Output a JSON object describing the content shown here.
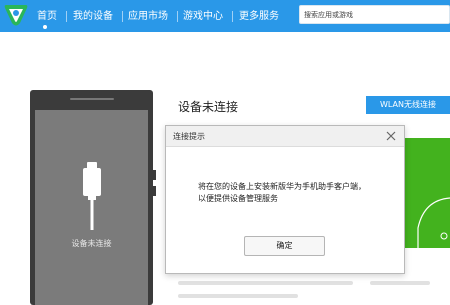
{
  "header": {
    "logo_icon": "app-logo-icon",
    "nav": [
      "首页",
      "我的设备",
      "应用市场",
      "游戏中心",
      "更多服务"
    ],
    "active_nav_index": 0,
    "search": {
      "placeholder": "搜索应用或游戏"
    }
  },
  "phone": {
    "status": "设备未连接",
    "icon": "usb-plug-icon"
  },
  "main": {
    "title": "设备未连接",
    "wlan_button": "WLAN无线连接"
  },
  "dialog": {
    "title": "连接提示",
    "message_lines": [
      "将在您的设备上安装新版华为手机助手客户端，",
      "以便提供设备管理服务"
    ],
    "ok_label": "确定",
    "close_icon": "close-icon"
  },
  "colors": {
    "accent": "#2a98e8",
    "green": "#43b21e",
    "phone_body": "#3b3b3b",
    "phone_screen": "#7b7b7b"
  }
}
